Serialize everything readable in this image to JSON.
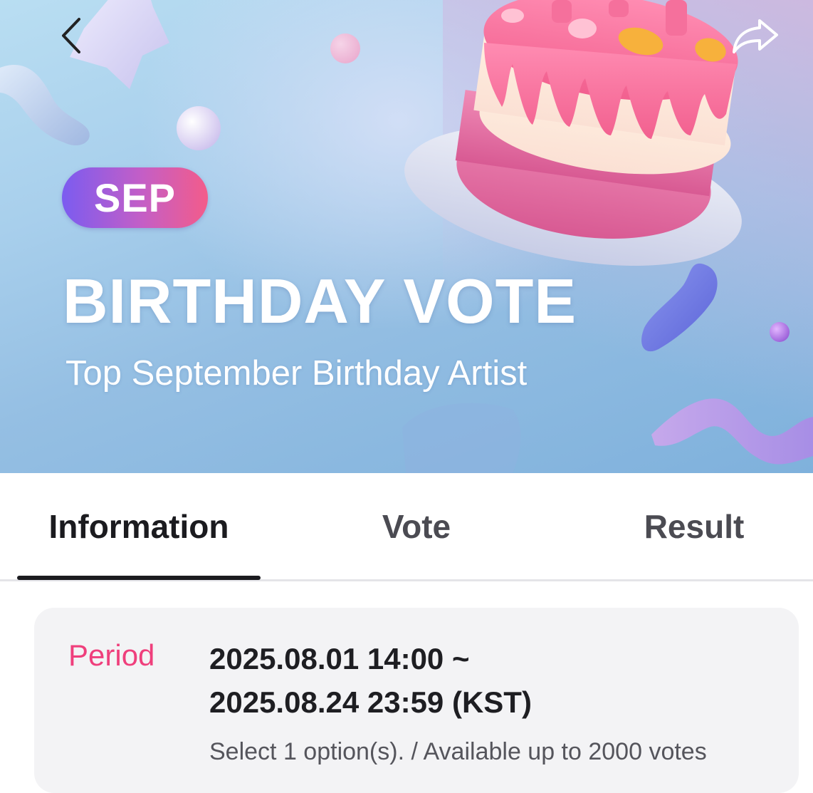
{
  "header": {
    "back_icon": "chevron-left-icon",
    "share_icon": "share-arrow-icon"
  },
  "banner": {
    "month_badge": "SEP",
    "title": "BIRTHDAY VOTE",
    "subtitle": "Top September Birthday Artist",
    "colors": {
      "badge_gradient_start": "#7b5cf0",
      "badge_gradient_end": "#f35c8a",
      "background": "#a8cfec"
    }
  },
  "tabs": [
    {
      "label": "Information",
      "active": true
    },
    {
      "label": "Vote",
      "active": false
    },
    {
      "label": "Result",
      "active": false
    }
  ],
  "info": {
    "period_label": "Period",
    "period_line1": "2025.08.01 14:00 ~",
    "period_line2": "2025.08.24 23:59 (KST)",
    "vote_rule": "Select 1 option(s). / Available up to 2000 votes",
    "accent_color": "#ef3f7c"
  }
}
